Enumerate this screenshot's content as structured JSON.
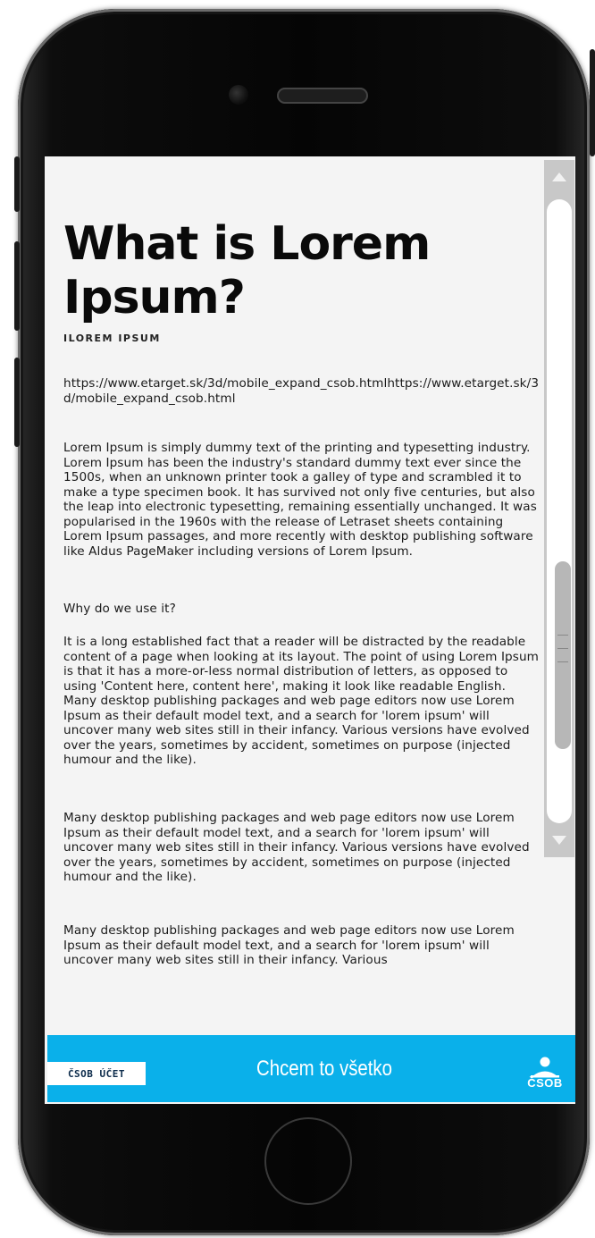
{
  "article": {
    "title": "What is Lorem Ipsum?",
    "subtitle": "ILOREM IPSUM",
    "url": "https://www.etarget.sk/3d/mobile_expand_csob.htmlhttps://www.etarget.sk/3d/mobile_expand_csob.html",
    "paragraph_1": "Lorem Ipsum is simply dummy text of the printing and typesetting industry. Lorem Ipsum has been the industry's standard dummy text ever since the 1500s, when an unknown printer took a galley of type and scrambled it to make a type specimen book. It has survived not only five centuries, but also the leap into electronic typesetting, remaining essentially unchanged. It was popularised in the 1960s with the release of Letraset sheets containing Lorem Ipsum passages, and more recently with desktop publishing software like Aldus PageMaker including versions of Lorem Ipsum.",
    "heading_why": "Why do we use it?",
    "paragraph_2": "It is a long established fact that a reader will be distracted by the readable content of a page when looking at its layout. The point of using Lorem Ipsum is that it has a more-or-less normal distribution of letters, as opposed to using 'Content here, content here', making it look like readable English. Many desktop publishing packages and web page editors now use Lorem Ipsum as their default model text, and a search for 'lorem ipsum' will uncover many web sites still in their infancy. Various versions have evolved over the years, sometimes by accident, sometimes on purpose (injected humour and the like).",
    "paragraph_3": " Many desktop publishing packages and web page editors now use Lorem Ipsum as their default model text, and a search for 'lorem ipsum' will uncover many web sites still in their infancy. Various versions have evolved over the years, sometimes by accident, sometimes on purpose (injected humour and the like).",
    "paragraph_4": " Many desktop publishing packages and web page editors now use Lorem Ipsum as their default model text, and a search for 'lorem ipsum' will uncover many web sites still in their infancy. Various"
  },
  "banner": {
    "chip_label": "ČSOB ÚČET",
    "cta_label": "Chcem to všetko",
    "logo_text": "ČSOB",
    "background_color": "#0ab0ea"
  },
  "icons": {
    "scroll_up": "triangle-up-icon",
    "scroll_down": "triangle-down-icon",
    "logo": "csob-logo-icon"
  }
}
